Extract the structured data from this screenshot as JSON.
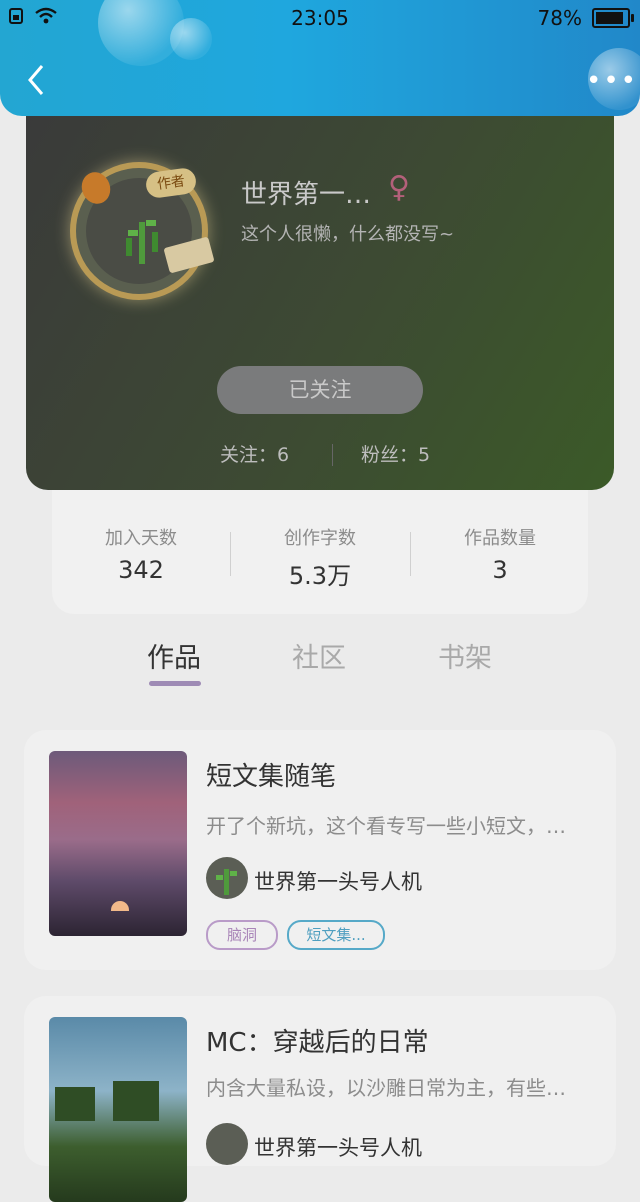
{
  "status": {
    "time": "23:05",
    "battery": "78%",
    "battery_level": 0.78
  },
  "profile": {
    "name": "世界第一…",
    "gender_symbol": "♀",
    "bio": "这个人很懒，什么都没写~",
    "badge": "作者",
    "follow_button": "已关注",
    "following": "关注：6",
    "fans": "粉丝：5"
  },
  "stats": [
    {
      "label": "加入天数",
      "value": "342"
    },
    {
      "label": "创作字数",
      "value": "5.3万"
    },
    {
      "label": "作品数量",
      "value": "3"
    }
  ],
  "tabs": [
    {
      "label": "作品",
      "active": true
    },
    {
      "label": "社区",
      "active": false
    },
    {
      "label": "书架",
      "active": false
    }
  ],
  "works": [
    {
      "title": "短文集随笔",
      "desc": "开了个新坑，这个看专写一些小短文，…",
      "author": "世界第一头号人机",
      "tags": [
        "脑洞",
        "短文集..."
      ]
    },
    {
      "title": "MC：穿越后的日常",
      "desc": "内含大量私设，以沙雕日常为主，有些…",
      "author": "世界第一头号人机"
    }
  ],
  "icons": {
    "back": "chevron-left-icon",
    "more": "more-horizontal-icon",
    "wifi": "wifi-icon",
    "sim": "sim-icon",
    "battery": "battery-icon"
  },
  "colors": {
    "topbar": "#1fa7de",
    "tab_indicator": "#9e8bb5"
  }
}
